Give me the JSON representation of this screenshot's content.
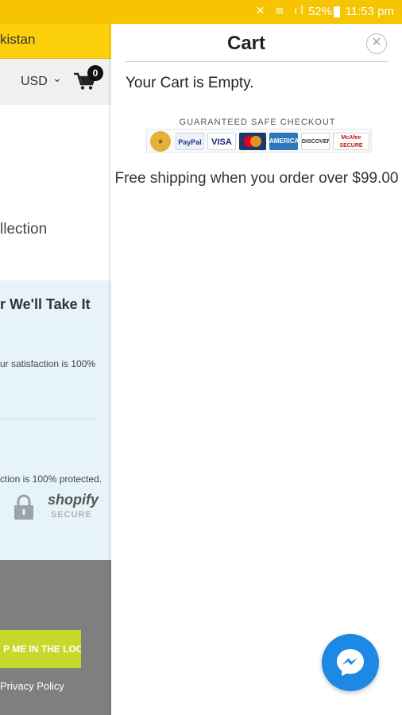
{
  "status_bar": {
    "battery": "52%",
    "time": "11:53 pm"
  },
  "background_page": {
    "header_text": "kistan",
    "currency": "USD",
    "cart_count": "0",
    "collection_text": "llection",
    "guarantee_heading": "r We'll Take It",
    "satisfaction_text": "ur satisfaction is 100%",
    "protection_text": "ction is 100% protected.",
    "shopify_label": "shopify",
    "shopify_secure": "SECURE",
    "newsletter_button": "P ME IN THE LOOP",
    "privacy_link": "Privacy Policy"
  },
  "cart": {
    "title": "Cart",
    "empty_message": "Your Cart is Empty.",
    "badge_title": "GUARANTEED SAFE CHECKOUT",
    "logos": {
      "paypal": "PayPal",
      "visa": "VISA",
      "amex": "AMERICAN",
      "discover": "DISCOVER",
      "mcafee_1": "McAfee",
      "mcafee_2": "SECURE"
    },
    "shipping_message": "Free shipping when you order over $99.00"
  },
  "colors": {
    "status_bar": "#f6c400",
    "header_yellow": "#fcd10b",
    "light_blue": "#e6f3f9",
    "footer_gray": "#7f7f7f",
    "newsletter_green": "#c6d92b",
    "messenger_blue": "#1e88e5"
  }
}
